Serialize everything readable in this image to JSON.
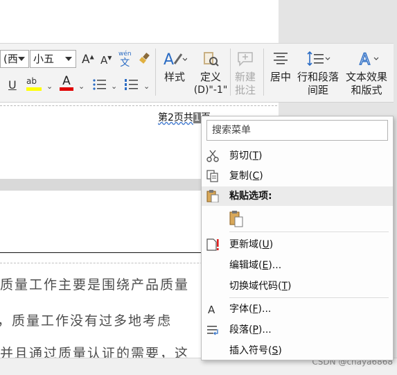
{
  "ribbon": {
    "font_name": "(西",
    "font_size": "小五",
    "grow_font": "A",
    "shrink_font": "A",
    "phonetic_top": "wén",
    "phonetic_bottom": "文",
    "underline": "U",
    "highlight": "ab",
    "font_color": "A",
    "styles_label": "样式",
    "define_line1": "定义",
    "define_line2": "(D)\"-1\"",
    "new_comment_line1": "新建",
    "new_comment_line2": "批注",
    "center_label": "居中",
    "line_spacing_line1": "行和段落",
    "line_spacing_line2": "间距",
    "text_effects_line1": "文本效果",
    "text_effects_line2": "和版式",
    "accent_blue": "#2b6cc4",
    "highlight_color": "#ffff00",
    "font_color_value": "#e00000"
  },
  "document": {
    "footer_prefix": "第2页共",
    "footer_field": "1",
    "footer_suffix": "页",
    "line1": "质量工作主要是围绕产品质量",
    "line2": "，质量工作没有过多地考虑",
    "line3": "并且通过质量认证的需要，这"
  },
  "context_menu": {
    "search_placeholder": "搜索菜单",
    "cut": "剪切",
    "cut_key": "T",
    "copy": "复制",
    "copy_key": "C",
    "paste_options": "粘贴选项:",
    "update_field": "更新域",
    "update_field_key": "U",
    "edit_field": "编辑域",
    "edit_field_key": "E",
    "edit_field_suffix": "...",
    "toggle_field_codes": "切换域代码",
    "toggle_field_codes_key": "T",
    "font": "字体",
    "font_key": "F",
    "font_suffix": "...",
    "paragraph": "段落",
    "paragraph_key": "P",
    "paragraph_suffix": "...",
    "insert_symbol": "插入符号",
    "insert_symbol_key": "S"
  },
  "watermark": "CSDN @chaya6868"
}
